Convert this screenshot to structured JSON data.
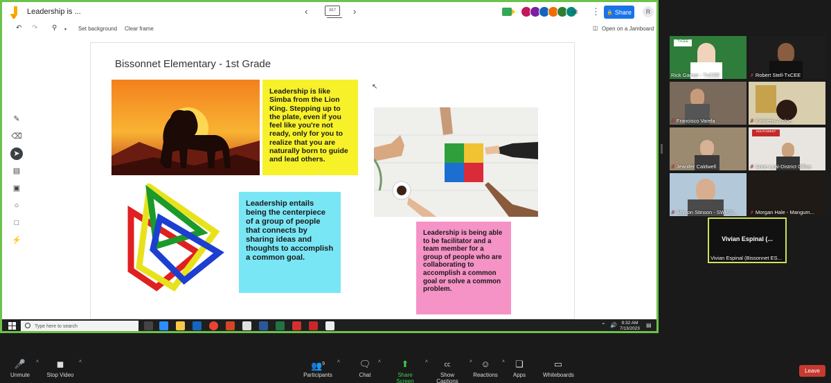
{
  "jamboard": {
    "title": "Leadership is ...",
    "frame_indicator": "3/17",
    "avatar_more": "+8",
    "share_label": "Share",
    "account_initial": "R",
    "toolbar": {
      "set_background": "Set background",
      "clear_frame": "Clear frame",
      "open_jamboard": "Open on a Jamboard"
    }
  },
  "slide": {
    "title": "Bissonnet Elementary - 1st Grade",
    "note_yellow": "Leadership is like Simba from the Lion King. Stepping up to the plate, even if you feel like you're not ready, only for you to realize that you are naturally born to guide and lead others.",
    "note_cyan": "Leadership entails being the centerpiece of a group of people that connects by sharing ideas and thoughts to accomplish a common goal.",
    "note_pink": "Leadership is being able to be facilitator and a team member for a group of people who are collaborating to accomplish a common goal or solve a common problem."
  },
  "taskbar": {
    "search_placeholder": "Type here to search",
    "time": "9:32 AM",
    "date": "7/13/2023"
  },
  "participants": [
    {
      "name": "Rick Garner - TxCEE"
    },
    {
      "name": "Robert Stell-TxCEE"
    },
    {
      "name": "Francisco Varela"
    },
    {
      "name": "Kimberly Archie"
    },
    {
      "name": "Jeanifer Caldwell"
    },
    {
      "name": "Anne Leal-District Office"
    },
    {
      "name": "Allyson Stinson - SWPS/..."
    },
    {
      "name": "Morgan Hale - Mangum..."
    }
  ],
  "active_speaker": {
    "display": "Vivian Espinal  (...",
    "name": "Vivian Espinal (Bissonnet ES..."
  },
  "zoom_controls": {
    "unmute": "Unmute",
    "stop_video": "Stop Video",
    "participants": "Participants",
    "participants_count": "9",
    "chat": "Chat",
    "share_screen": "Share Screen",
    "show_captions": "Show Captions",
    "reactions": "Reactions",
    "apps": "Apps",
    "whiteboards": "Whiteboards",
    "leave": "Leave"
  },
  "colors": {
    "share_border": "#6cc24a",
    "note_yellow": "#f7f12a",
    "note_cyan": "#79e6f5",
    "note_pink": "#f592c6",
    "leave": "#c53a2f",
    "share_screen": "#3ccf4e"
  }
}
